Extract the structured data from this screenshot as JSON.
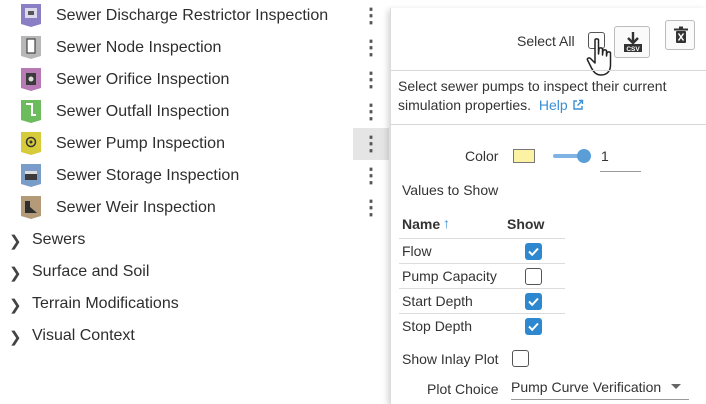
{
  "tree": {
    "items": [
      {
        "label": "Sewer Discharge Restrictor Inspection",
        "icon": "discharge-restrictor-icon",
        "color": "#8a7fc4"
      },
      {
        "label": "Sewer Node Inspection",
        "icon": "node-icon",
        "color": "#9a9a9a"
      },
      {
        "label": "Sewer Orifice Inspection",
        "icon": "orifice-icon",
        "color": "#b77ab4"
      },
      {
        "label": "Sewer Outfall Inspection",
        "icon": "outfall-icon",
        "color": "#6cbb5c"
      },
      {
        "label": "Sewer Pump Inspection",
        "icon": "pump-icon",
        "color": "#d6cb3b"
      },
      {
        "label": "Sewer Storage Inspection",
        "icon": "storage-icon",
        "color": "#7a9cc8"
      },
      {
        "label": "Sewer Weir Inspection",
        "icon": "weir-icon",
        "color": "#b49a78"
      }
    ],
    "folders": [
      {
        "label": "Sewers"
      },
      {
        "label": "Surface and Soil"
      },
      {
        "label": "Terrain Modifications"
      },
      {
        "label": "Visual Context"
      }
    ]
  },
  "panel": {
    "select_all_label": "Select All",
    "csv_label": "CSV",
    "description": "Select sewer pumps to inspect their current simulation properties.",
    "help_label": "Help",
    "color_label": "Color",
    "color_value": "#fbf3a3",
    "slider_value": "1",
    "values_to_show_label": "Values to Show",
    "table": {
      "name_header": "Name",
      "show_header": "Show",
      "rows": [
        {
          "name": "Flow",
          "checked": true
        },
        {
          "name": "Pump Capacity",
          "checked": false
        },
        {
          "name": "Start Depth",
          "checked": true
        },
        {
          "name": "Stop Depth",
          "checked": true
        }
      ]
    },
    "show_inlay_label": "Show Inlay Plot",
    "plot_choice_label": "Plot Choice",
    "plot_choice_value": "Pump Curve Verification"
  }
}
